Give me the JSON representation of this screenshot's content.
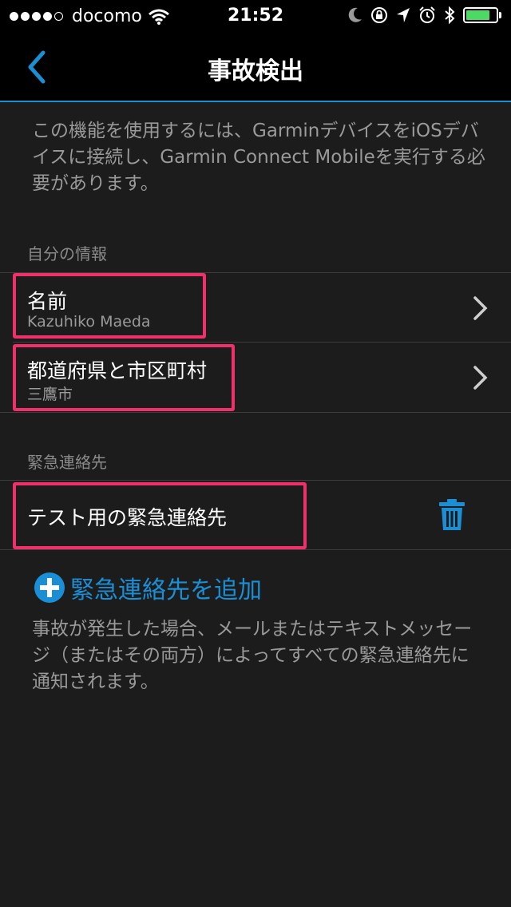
{
  "status_bar": {
    "carrier": "docomo",
    "time": "21:52",
    "battery_level": 0.8,
    "battery_color": "#4cd964"
  },
  "nav": {
    "title": "事故検出",
    "back_icon": "chevron-left-icon",
    "accent_color": "#1a8fd6"
  },
  "intro_text": "この機能を使用するには、GarminデバイスをiOSデバイスに接続し、Garmin Connect Mobileを実行する必要があります。",
  "my_info": {
    "header": "自分の情報",
    "items": [
      {
        "title": "名前",
        "value": "Kazuhiko Maeda"
      },
      {
        "title": "都道府県と市区町村",
        "value": "三鷹市"
      }
    ]
  },
  "emergency": {
    "header": "緊急連絡先",
    "contacts": [
      {
        "name": "テスト用の緊急連絡先"
      }
    ],
    "add_label": "緊急連絡先を追加"
  },
  "footer_note": "事故が発生した場合、メールまたはテキストメッセージ（またはその両方）によってすべての緊急連絡先に通知されます。",
  "highlight_color": "#f0306a"
}
